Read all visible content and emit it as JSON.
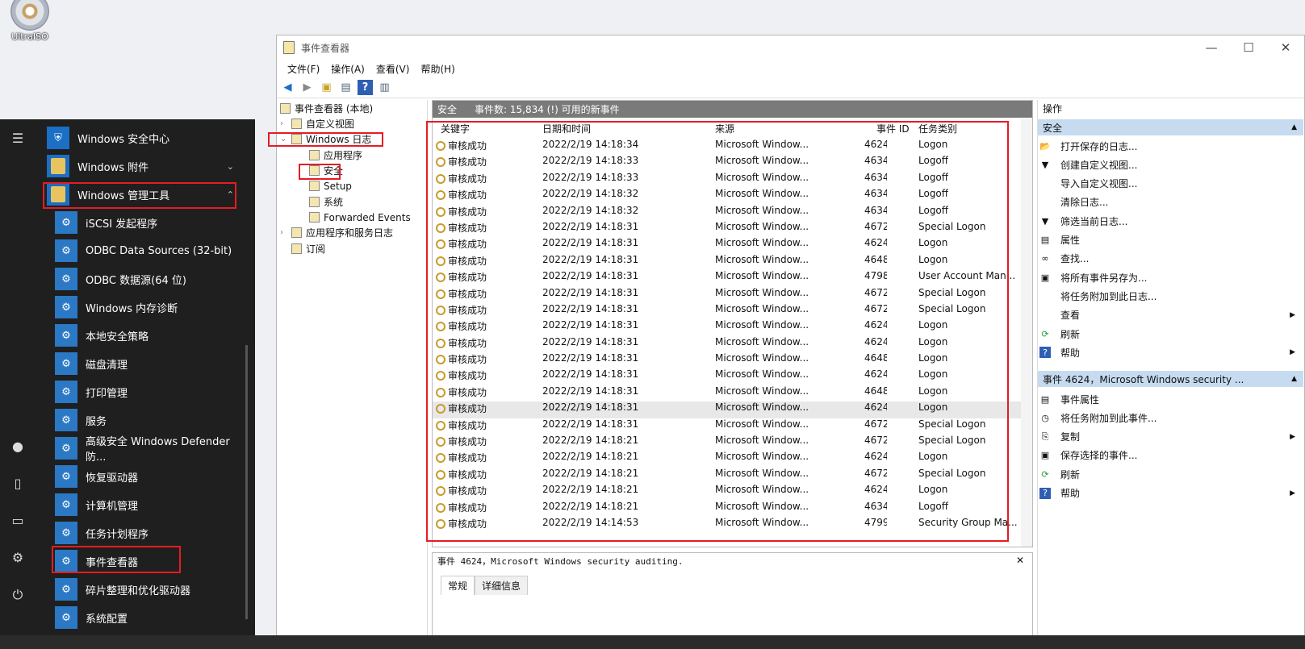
{
  "desktop": {
    "icon_label": "UltraISO"
  },
  "start_menu": {
    "rail_icons": [
      "hamburger-icon",
      "user-icon",
      "document-icon",
      "pictures-icon",
      "settings-icon",
      "power-icon"
    ],
    "items": [
      {
        "label": "Windows 安全中心"
      },
      {
        "label": "Windows 附件"
      },
      {
        "label": "Windows 管理工具"
      },
      {
        "label": "iSCSI 发起程序"
      },
      {
        "label": "ODBC Data Sources (32-bit)"
      },
      {
        "label": "ODBC 数据源(64 位)"
      },
      {
        "label": "Windows 内存诊断"
      },
      {
        "label": "本地安全策略"
      },
      {
        "label": "磁盘清理"
      },
      {
        "label": "打印管理"
      },
      {
        "label": "服务"
      },
      {
        "label": "高级安全 Windows Defender 防..."
      },
      {
        "label": "恢复驱动器"
      },
      {
        "label": "计算机管理"
      },
      {
        "label": "任务计划程序"
      },
      {
        "label": "事件查看器"
      },
      {
        "label": "碎片整理和优化驱动器"
      },
      {
        "label": "系统配置"
      }
    ]
  },
  "window": {
    "title": "事件查看器",
    "controls": {
      "min": "—",
      "max": "☐",
      "close": "✕"
    },
    "menu": [
      "文件(F)",
      "操作(A)",
      "查看(V)",
      "帮助(H)"
    ],
    "tree": [
      {
        "label": "事件查看器 (本地)"
      },
      {
        "label": "自定义视图"
      },
      {
        "label": "Windows 日志"
      },
      {
        "label": "应用程序"
      },
      {
        "label": "安全"
      },
      {
        "label": "Setup"
      },
      {
        "label": "系统"
      },
      {
        "label": "Forwarded Events"
      },
      {
        "label": "应用程序和服务日志"
      },
      {
        "label": "订阅"
      }
    ],
    "list_header": {
      "name": "安全",
      "info": "事件数: 15,834 (!) 可用的新事件"
    },
    "columns": [
      "关键字",
      "日期和时间",
      "来源",
      "事件 ID",
      "任务类别"
    ],
    "rows": [
      {
        "k": "审核成功",
        "d": "2022/2/19 14:18:34",
        "s": "Microsoft Window...",
        "id": "4624",
        "c": "Logon"
      },
      {
        "k": "审核成功",
        "d": "2022/2/19 14:18:33",
        "s": "Microsoft Window...",
        "id": "4634",
        "c": "Logoff"
      },
      {
        "k": "审核成功",
        "d": "2022/2/19 14:18:33",
        "s": "Microsoft Window...",
        "id": "4634",
        "c": "Logoff"
      },
      {
        "k": "审核成功",
        "d": "2022/2/19 14:18:32",
        "s": "Microsoft Window...",
        "id": "4634",
        "c": "Logoff"
      },
      {
        "k": "审核成功",
        "d": "2022/2/19 14:18:32",
        "s": "Microsoft Window...",
        "id": "4634",
        "c": "Logoff"
      },
      {
        "k": "审核成功",
        "d": "2022/2/19 14:18:31",
        "s": "Microsoft Window...",
        "id": "4672",
        "c": "Special Logon"
      },
      {
        "k": "审核成功",
        "d": "2022/2/19 14:18:31",
        "s": "Microsoft Window...",
        "id": "4624",
        "c": "Logon"
      },
      {
        "k": "审核成功",
        "d": "2022/2/19 14:18:31",
        "s": "Microsoft Window...",
        "id": "4648",
        "c": "Logon"
      },
      {
        "k": "审核成功",
        "d": "2022/2/19 14:18:31",
        "s": "Microsoft Window...",
        "id": "4798",
        "c": "User Account Man..."
      },
      {
        "k": "审核成功",
        "d": "2022/2/19 14:18:31",
        "s": "Microsoft Window...",
        "id": "4672",
        "c": "Special Logon"
      },
      {
        "k": "审核成功",
        "d": "2022/2/19 14:18:31",
        "s": "Microsoft Window...",
        "id": "4672",
        "c": "Special Logon"
      },
      {
        "k": "审核成功",
        "d": "2022/2/19 14:18:31",
        "s": "Microsoft Window...",
        "id": "4624",
        "c": "Logon"
      },
      {
        "k": "审核成功",
        "d": "2022/2/19 14:18:31",
        "s": "Microsoft Window...",
        "id": "4624",
        "c": "Logon"
      },
      {
        "k": "审核成功",
        "d": "2022/2/19 14:18:31",
        "s": "Microsoft Window...",
        "id": "4648",
        "c": "Logon"
      },
      {
        "k": "审核成功",
        "d": "2022/2/19 14:18:31",
        "s": "Microsoft Window...",
        "id": "4624",
        "c": "Logon"
      },
      {
        "k": "审核成功",
        "d": "2022/2/19 14:18:31",
        "s": "Microsoft Window...",
        "id": "4648",
        "c": "Logon"
      },
      {
        "k": "审核成功",
        "d": "2022/2/19 14:18:31",
        "s": "Microsoft Window...",
        "id": "4624",
        "c": "Logon"
      },
      {
        "k": "审核成功",
        "d": "2022/2/19 14:18:31",
        "s": "Microsoft Window...",
        "id": "4672",
        "c": "Special Logon"
      },
      {
        "k": "审核成功",
        "d": "2022/2/19 14:18:21",
        "s": "Microsoft Window...",
        "id": "4672",
        "c": "Special Logon"
      },
      {
        "k": "审核成功",
        "d": "2022/2/19 14:18:21",
        "s": "Microsoft Window...",
        "id": "4624",
        "c": "Logon"
      },
      {
        "k": "审核成功",
        "d": "2022/2/19 14:18:21",
        "s": "Microsoft Window...",
        "id": "4672",
        "c": "Special Logon"
      },
      {
        "k": "审核成功",
        "d": "2022/2/19 14:18:21",
        "s": "Microsoft Window...",
        "id": "4624",
        "c": "Logon"
      },
      {
        "k": "审核成功",
        "d": "2022/2/19 14:18:21",
        "s": "Microsoft Window...",
        "id": "4634",
        "c": "Logoff"
      },
      {
        "k": "审核成功",
        "d": "2022/2/19 14:14:53",
        "s": "Microsoft Window...",
        "id": "4799",
        "c": "Security Group Ma..."
      }
    ],
    "selected_row": 16,
    "detail": {
      "title": "事件 4624，Microsoft Windows security auditing.",
      "close": "✕",
      "tabs": [
        "常规",
        "详细信息"
      ]
    },
    "actions": {
      "header": "操作",
      "section1": "安全",
      "items1": [
        {
          "label": "打开保存的日志...",
          "icon": "folder-open-icon"
        },
        {
          "label": "创建自定义视图...",
          "icon": "filter-icon"
        },
        {
          "label": "导入自定义视图...",
          "icon": ""
        },
        {
          "label": "清除日志...",
          "icon": ""
        },
        {
          "label": "筛选当前日志...",
          "icon": "filter-icon"
        },
        {
          "label": "属性",
          "icon": "properties-icon"
        },
        {
          "label": "查找...",
          "icon": "binoculars-icon"
        },
        {
          "label": "将所有事件另存为...",
          "icon": "save-icon"
        },
        {
          "label": "将任务附加到此日志...",
          "icon": ""
        },
        {
          "label": "查看",
          "icon": "",
          "sub": true
        },
        {
          "label": "刷新",
          "icon": "refresh-icon"
        },
        {
          "label": "帮助",
          "icon": "help-icon",
          "sub": true
        }
      ],
      "section2": "事件 4624，Microsoft Windows security ...",
      "items2": [
        {
          "label": "事件属性",
          "icon": "properties-icon"
        },
        {
          "label": "将任务附加到此事件...",
          "icon": "task-icon"
        },
        {
          "label": "复制",
          "icon": "copy-icon",
          "sub": true
        },
        {
          "label": "保存选择的事件...",
          "icon": "save-icon"
        },
        {
          "label": "刷新",
          "icon": "refresh-icon"
        },
        {
          "label": "帮助",
          "icon": "help-icon",
          "sub": true
        }
      ]
    }
  },
  "colors": {
    "highlight": "#e51c23",
    "pane_header": "#7a7a7a",
    "action_section": "#c6dbef"
  }
}
